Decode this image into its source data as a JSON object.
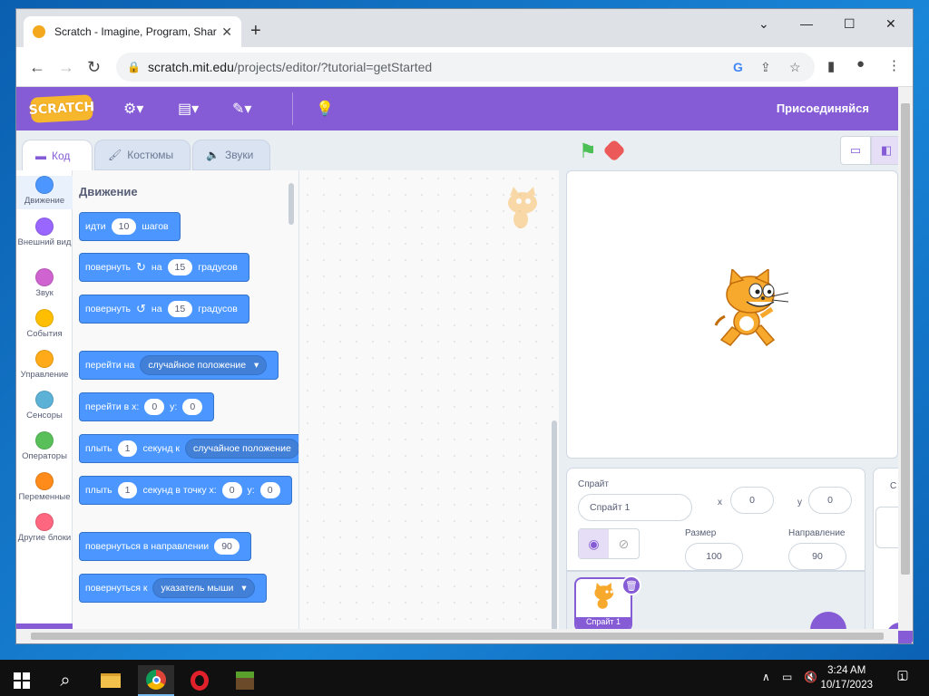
{
  "browser": {
    "tab_title": "Scratch - Imagine, Program, Shar",
    "url_host": "scratch.mit.edu",
    "url_path": "/projects/editor/?tutorial=getStarted"
  },
  "menubar": {
    "logo": "SCRATCH",
    "join_label": "Присоединяйся"
  },
  "editor_tabs": [
    {
      "label": "Код"
    },
    {
      "label": "Костюмы"
    },
    {
      "label": "Звуки"
    }
  ],
  "categories": [
    {
      "label": "Движение",
      "color": "#4c97ff"
    },
    {
      "label": "Внешний вид",
      "color": "#9966ff"
    },
    {
      "label": "Звук",
      "color": "#cf63cf"
    },
    {
      "label": "События",
      "color": "#ffbf00"
    },
    {
      "label": "Управление",
      "color": "#ffab19"
    },
    {
      "label": "Сенсоры",
      "color": "#5cb1d6"
    },
    {
      "label": "Операторы",
      "color": "#59c059"
    },
    {
      "label": "Переменные",
      "color": "#ff8c1a"
    },
    {
      "label": "Другие блоки",
      "color": "#ff6680"
    }
  ],
  "palette": {
    "heading": "Движение",
    "blocks": {
      "move": {
        "a": "идти",
        "v": "10",
        "b": "шагов"
      },
      "turn_cw": {
        "a": "повернуть",
        "b": "на",
        "v": "15",
        "c": "градусов"
      },
      "turn_ccw": {
        "a": "повернуть",
        "b": "на",
        "v": "15",
        "c": "градусов"
      },
      "goto": {
        "a": "перейти на",
        "drop": "случайное положение"
      },
      "goto_xy": {
        "a": "перейти в x:",
        "x": "0",
        "b": "y:",
        "y": "0"
      },
      "glide": {
        "a": "плыть",
        "v": "1",
        "b": "секунд к",
        "drop": "случайное положение"
      },
      "glide_xy": {
        "a": "плыть",
        "v": "1",
        "b": "секунд в точку x:",
        "x": "0",
        "c": "y:",
        "y": "0"
      },
      "point_dir": {
        "a": "повернуться в направлении",
        "v": "90"
      },
      "point_towards": {
        "a": "повернуться к",
        "drop": "указатель мыши"
      }
    }
  },
  "sprite_info": {
    "sprite_label": "Спрайт",
    "sprite_name": "Спрайт 1",
    "x_label": "x",
    "x_value": "0",
    "y_label": "y",
    "y_value": "0",
    "size_label": "Размер",
    "size_value": "100",
    "direction_label": "Направление",
    "direction_value": "90"
  },
  "sprite_list": {
    "thumb_label": "Спрайт 1"
  },
  "stage_panel": {
    "label": "С"
  },
  "taskbar": {
    "time": "3:24 AM",
    "date": "10/17/2023",
    "notification_count": "1"
  }
}
